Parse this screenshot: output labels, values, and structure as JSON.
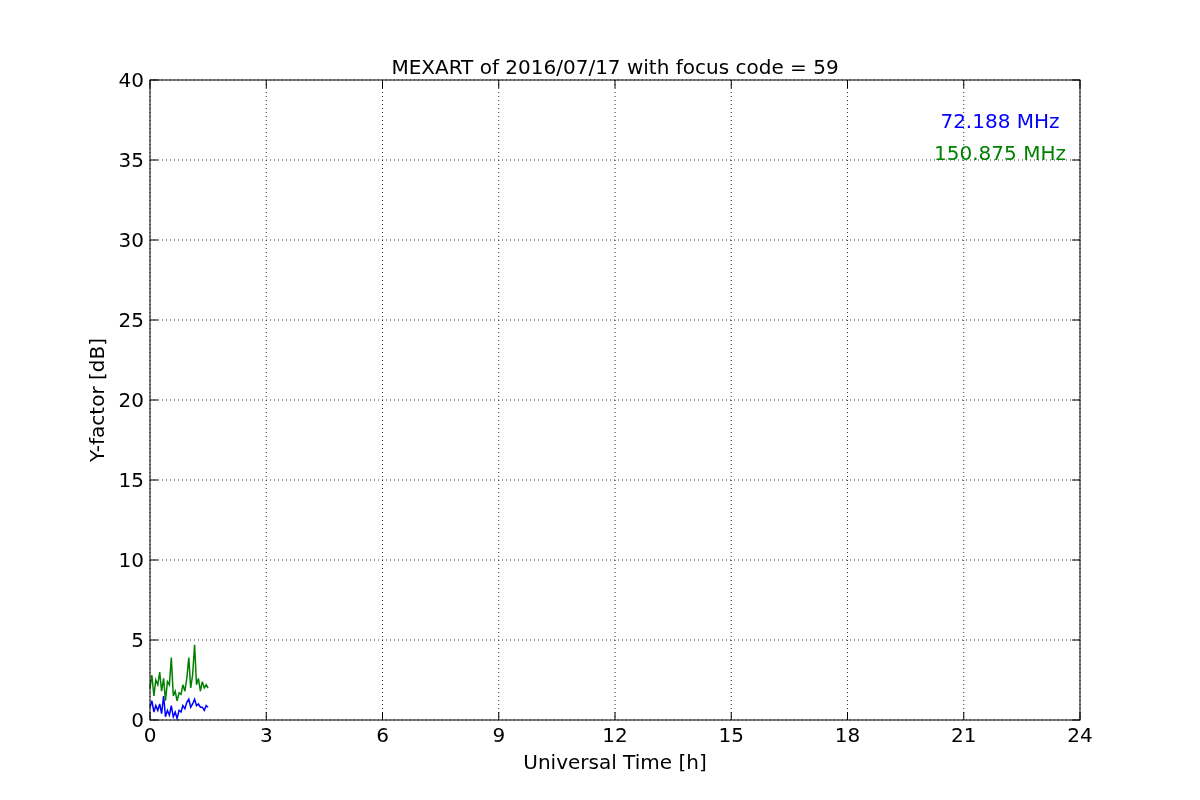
{
  "figure": {
    "chart_data": {
      "type": "line",
      "title": "MEXART of 2016/07/17 with focus code = 59",
      "xlabel": "Universal Time [h]",
      "ylabel": "Y-factor [dB]",
      "x": [
        0,
        0.05,
        0.1,
        0.15,
        0.2,
        0.25,
        0.3,
        0.35,
        0.4,
        0.45,
        0.5,
        0.55,
        0.6,
        0.65,
        0.7,
        0.75,
        0.8,
        0.85,
        0.9,
        0.95,
        1,
        1.05,
        1.1,
        1.15,
        1.2,
        1.25,
        1.3,
        1.35,
        1.4,
        1.45,
        1.5
      ],
      "series": [
        {
          "name": "72.188 MHz",
          "color": "#0000ff",
          "values": [
            0.8,
            1.2,
            0.5,
            0.9,
            0.6,
            1.0,
            0.4,
            1.5,
            0.2,
            0.6,
            0.3,
            0.9,
            0.2,
            0.5,
            0.1,
            0.6,
            0.5,
            0.9,
            0.7,
            1.1,
            1.3,
            0.8,
            1.0,
            1.3,
            0.9,
            1.0,
            0.8,
            0.8,
            0.6,
            0.9,
            0.8
          ]
        },
        {
          "name": "150.875 MHz",
          "color": "#008000",
          "values": [
            2,
            2.8,
            1.5,
            2.5,
            2.2,
            3,
            1.8,
            2.6,
            1.2,
            2.4,
            2.2,
            3.9,
            1.5,
            1.8,
            1.2,
            1.7,
            1.6,
            2.2,
            1.8,
            2.6,
            3.9,
            2,
            2.8,
            4.7,
            2.2,
            2.6,
            1.8,
            2.4,
            2,
            2.2,
            2
          ]
        }
      ],
      "xlim": [
        0,
        24
      ],
      "ylim": [
        0,
        40
      ],
      "xticks": [
        0,
        3,
        6,
        9,
        12,
        15,
        18,
        21,
        24
      ],
      "yticks": [
        0,
        5,
        10,
        15,
        20,
        25,
        30,
        35,
        40
      ],
      "grid": true
    }
  }
}
